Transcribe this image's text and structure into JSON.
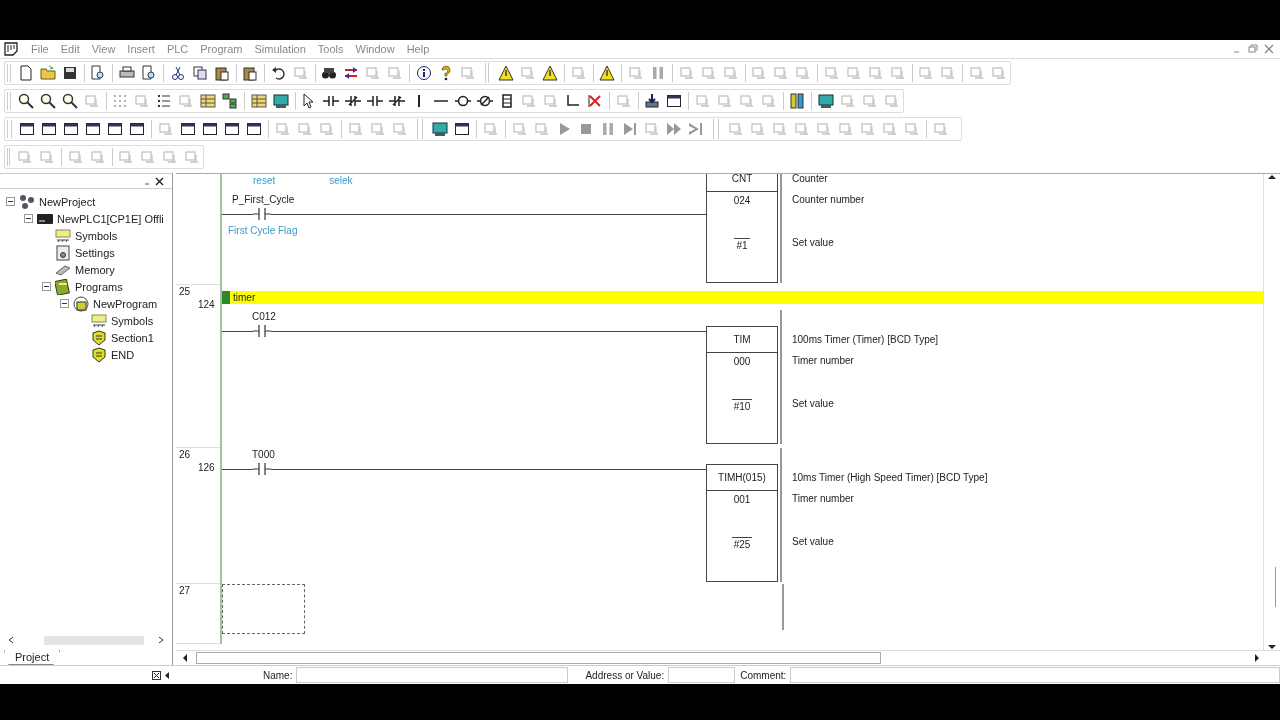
{
  "menu": [
    "File",
    "Edit",
    "View",
    "Insert",
    "PLC",
    "Program",
    "Simulation",
    "Tools",
    "Window",
    "Help"
  ],
  "project_tree": {
    "tab": "Project",
    "items": [
      {
        "label": "NewProject",
        "kind": "project",
        "expanded": true,
        "children": [
          {
            "label": "NewPLC1[CP1E] Offli",
            "kind": "plc",
            "expanded": true,
            "children": [
              {
                "label": "Symbols",
                "kind": "symbols"
              },
              {
                "label": "Settings",
                "kind": "settings"
              },
              {
                "label": "Memory",
                "kind": "memory"
              },
              {
                "label": "Programs",
                "kind": "programs",
                "expanded": true,
                "children": [
                  {
                    "label": "NewProgram",
                    "kind": "program",
                    "expanded": true,
                    "children": [
                      {
                        "label": "Symbols",
                        "kind": "symbols"
                      },
                      {
                        "label": "Section1",
                        "kind": "section"
                      },
                      {
                        "label": "END",
                        "kind": "section"
                      }
                    ]
                  }
                ]
              }
            ]
          }
        ]
      }
    ]
  },
  "ladder": {
    "rungs": [
      {
        "cursor": false,
        "annotations": [
          "reset",
          "selek"
        ],
        "contact": {
          "operand": "P_First_Cycle",
          "comment": "First Cycle Flag"
        },
        "instruction": {
          "opcode": "CNT",
          "operand": "024",
          "set_value": "#1",
          "descriptions": [
            "Counter",
            "Counter number",
            "Set value"
          ]
        }
      },
      {
        "number": "25",
        "address": "124",
        "comment": "timer",
        "cursor": false,
        "contact": {
          "operand": "C012"
        },
        "instruction": {
          "opcode": "TIM",
          "operand": "000",
          "set_value": "#10",
          "descriptions": [
            "100ms Timer (Timer) [BCD Type]",
            "Timer number",
            "Set value"
          ]
        }
      },
      {
        "number": "26",
        "address": "126",
        "cursor": false,
        "contact": {
          "operand": "T000"
        },
        "instruction": {
          "opcode": "TIMH(015)",
          "operand": "001",
          "set_value": "#25",
          "descriptions": [
            "10ms Timer (High Speed Timer) [BCD Type]",
            "Timer number",
            "Set value"
          ]
        }
      },
      {
        "number": "27",
        "cursor": true
      }
    ]
  },
  "input_bar": {
    "fields": [
      {
        "label": "Name:"
      },
      {
        "label": "Address or Value:"
      },
      {
        "label": "Comment:"
      }
    ]
  }
}
